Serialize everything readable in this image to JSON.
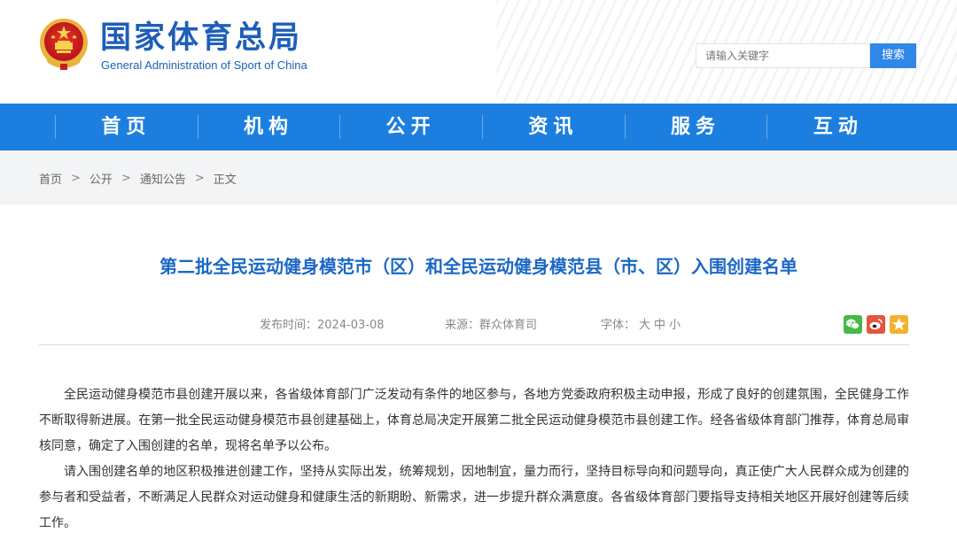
{
  "header": {
    "title_cn": "国家体育总局",
    "title_en": "General Administration of Sport of China",
    "search_placeholder": "请输入关键字",
    "search_button": "搜索"
  },
  "nav": {
    "items": [
      "首页",
      "机构",
      "公开",
      "资讯",
      "服务",
      "互动"
    ]
  },
  "breadcrumb": {
    "items": [
      "首页",
      "公开",
      "通知公告",
      "正文"
    ],
    "separator": ">"
  },
  "article": {
    "title": "第二批全民运动健身模范市（区）和全民运动健身模范县（市、区）入围创建名单",
    "date_label": "发布时间：2024-03-08",
    "source_label": "来源：群众体育司",
    "font_label": "字体：",
    "font_options": [
      "大",
      "中",
      "小"
    ],
    "paragraphs": [
      "全民运动健身模范市县创建开展以来，各省级体育部门广泛发动有条件的地区参与，各地方党委政府积极主动申报，形成了良好的创建氛围，全民健身工作不断取得新进展。在第一批全民运动健身模范市县创建基础上，体育总局决定开展第二批全民运动健身模范市县创建工作。经各省级体育部门推荐，体育总局审核同意，确定了入围创建的名单，现将名单予以公布。",
      "请入围创建名单的地区积极推进创建工作，坚持从实际出发，统筹规划，因地制宜，量力而行，坚持目标导向和问题导向，真正使广大人民群众成为创建的参与者和受益者，不断满足人民群众对运动健身和健康生活的新期盼、新需求，进一步提升群众满意度。各省级体育部门要指导支持相关地区开展好创建等后续工作。"
    ]
  },
  "share": {
    "icons": [
      "wechat-icon",
      "weibo-icon",
      "qzone-icon"
    ]
  },
  "colors": {
    "brand_blue": "#1c7fe0",
    "title_blue": "#1c68c6",
    "logo_blue": "#1d5fb8"
  }
}
